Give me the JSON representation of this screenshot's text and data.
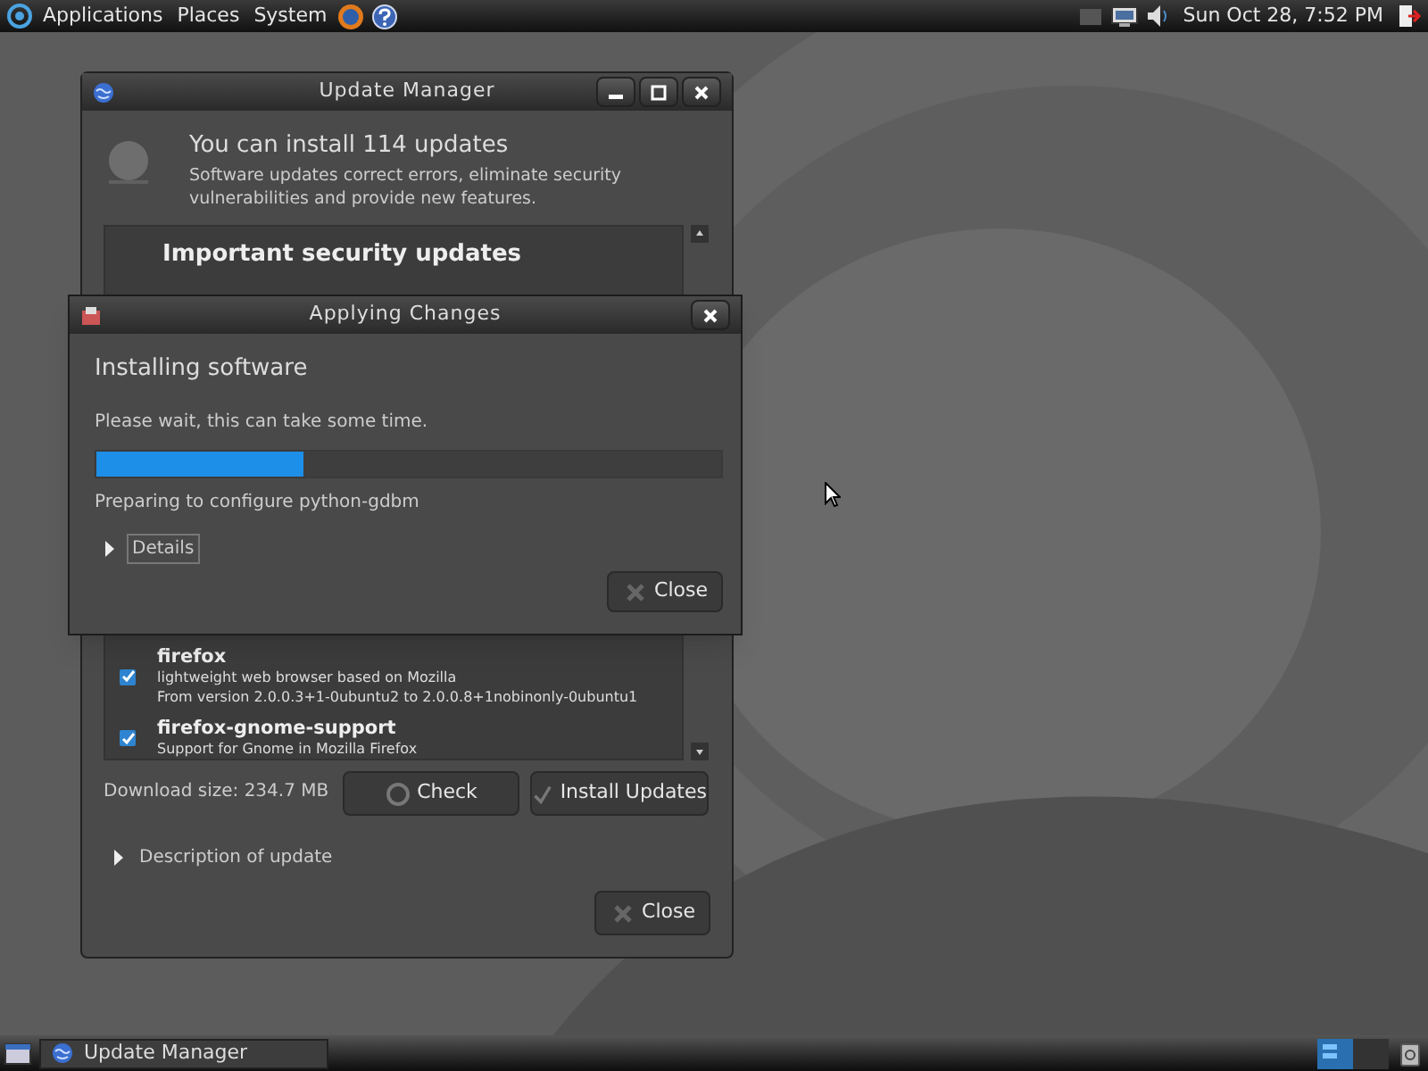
{
  "top_panel": {
    "menus": [
      "Applications",
      "Places",
      "System"
    ],
    "clock": "Sun Oct 28, 7:52 PM"
  },
  "update_manager": {
    "title": "Update Manager",
    "heading": "You can install 114 updates",
    "description": "Software updates correct errors, eliminate security vulnerabilities and provide new features.",
    "updates": [
      {
        "kind": "header",
        "name": "Important security updates"
      },
      {
        "kind": "package",
        "name": "firefox",
        "checked": true,
        "description": "lightweight web browser based on Mozilla",
        "version": "From version 2.0.0.3+1-0ubuntu2 to 2.0.0.8+1nobinonly-0ubuntu1"
      },
      {
        "kind": "package",
        "name": "firefox-gnome-support",
        "checked": true,
        "description": "Support for Gnome in Mozilla Firefox"
      }
    ],
    "download_size": "Download size: 234.7 MB",
    "buttons": [
      {
        "kind": "check",
        "label": "Check"
      },
      {
        "kind": "install",
        "label": "Install Updates"
      }
    ],
    "expander": {
      "label": "Description of update",
      "expanded": false
    },
    "close_button": "Close"
  },
  "dialog": {
    "title": "Applying Changes",
    "heading": "Installing software",
    "message": "Please wait, this can take some time.",
    "progress": {
      "level": 0.33
    },
    "status": "Preparing to configure python-gdbm",
    "details": {
      "label": "Details",
      "expanded": false
    },
    "close_button": "Close"
  },
  "taskbar": {
    "tasks": [
      {
        "label": "Update Manager",
        "selected": false
      }
    ]
  }
}
